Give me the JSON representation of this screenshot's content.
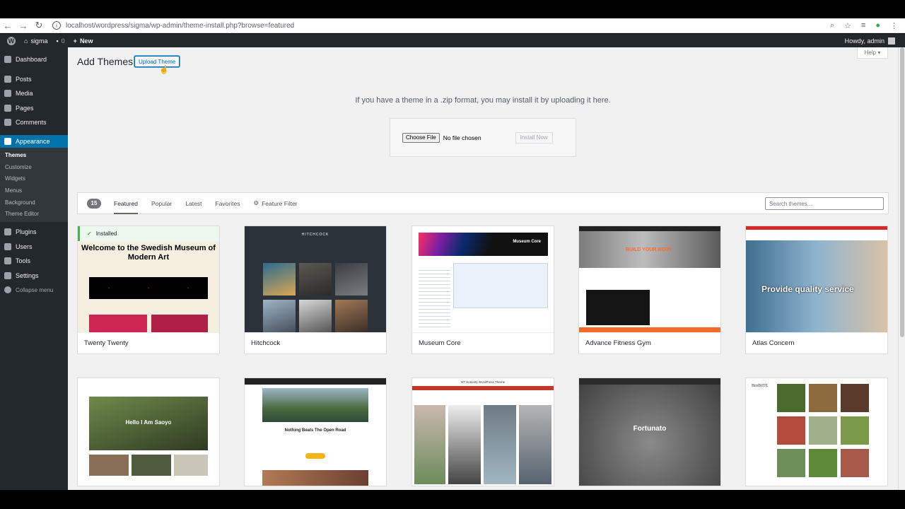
{
  "browser": {
    "url": "localhost/wordpress/sigma/wp-admin/theme-install.php?browse=featured"
  },
  "admin_bar": {
    "site_name": "sigma",
    "comments_count": "0",
    "new_label": "New",
    "howdy": "Howdy, admin"
  },
  "sidebar": {
    "items_top": [
      {
        "label": "Dashboard",
        "icon": "dashboard-icon"
      }
    ],
    "items_mid": [
      {
        "label": "Posts",
        "icon": "pin-icon"
      },
      {
        "label": "Media",
        "icon": "media-icon"
      },
      {
        "label": "Pages",
        "icon": "pages-icon"
      },
      {
        "label": "Comments",
        "icon": "comment-icon"
      }
    ],
    "active": {
      "label": "Appearance",
      "icon": "paintbrush-icon"
    },
    "submenu": [
      "Themes",
      "Customize",
      "Widgets",
      "Menus",
      "Background",
      "Theme Editor"
    ],
    "items_bottom": [
      {
        "label": "Plugins",
        "icon": "plugin-icon"
      },
      {
        "label": "Users",
        "icon": "users-icon"
      },
      {
        "label": "Tools",
        "icon": "tools-icon"
      },
      {
        "label": "Settings",
        "icon": "settings-icon"
      },
      {
        "label": "Collapse menu",
        "icon": "collapse-icon"
      }
    ]
  },
  "help_label": "Help",
  "page": {
    "title": "Add Themes",
    "upload_button": "Upload Theme",
    "upload_text": "If you have a theme in a .zip format, you may install it by uploading it here.",
    "choose_file": "Choose File",
    "no_file": "No file chosen",
    "install_now": "Install Now"
  },
  "filter": {
    "count": "15",
    "tabs": [
      "Featured",
      "Popular",
      "Latest",
      "Favorites"
    ],
    "feature_filter": "Feature Filter",
    "search_placeholder": "Search themes..."
  },
  "installed_label": "Installed",
  "themes_row1": [
    {
      "name": "Twenty Twenty",
      "headline": "Welcome to the Swedish Museum of Modern Art"
    },
    {
      "name": "Hitchcock",
      "headline": "HITCHCOCK"
    },
    {
      "name": "Museum Core",
      "headline": "Museum Core"
    },
    {
      "name": "Advance Fitness Gym",
      "headline": "BUILD YOUR BODY"
    },
    {
      "name": "Atlas Concern",
      "headline": "Provide quality service"
    }
  ],
  "themes_row2": [
    {
      "headline": "Hello I Am Saoyo"
    },
    {
      "headline": "Nothing Beats The Open Road"
    },
    {
      "headline": "NT Honesty WordPress Theme"
    },
    {
      "headline": "Fortunato"
    },
    {
      "headline": "BirdSITE"
    }
  ],
  "colors": {
    "admin_dark": "#23282d",
    "accent_blue": "#0073aa",
    "installed_green": "#46b450",
    "page_bg": "#f1f1f1"
  }
}
